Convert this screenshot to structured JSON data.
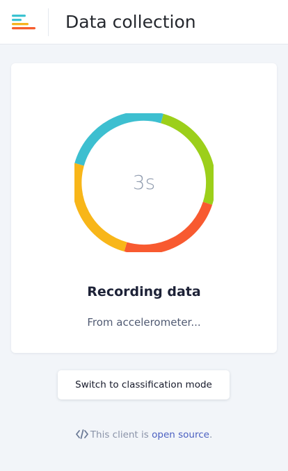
{
  "header": {
    "title": "Data collection",
    "logo_icon": "edge-impulse-logo-icon",
    "logo_colors": [
      "#3cc3d1",
      "#f7b31f",
      "#f65d2e"
    ]
  },
  "recording": {
    "countdown": "3s",
    "title": "Recording data",
    "subtitle": "From accelerometer...",
    "ring_colors": [
      "#3dbfd0",
      "#9ccf1a",
      "#f85a30",
      "#f8b619"
    ]
  },
  "actions": {
    "switch_mode_label": "Switch to classification mode"
  },
  "footer": {
    "icon": "code-icon",
    "prefix": "This client is",
    "link_text": "open source",
    "suffix": ".",
    "link_color": "#4a5fc1"
  }
}
